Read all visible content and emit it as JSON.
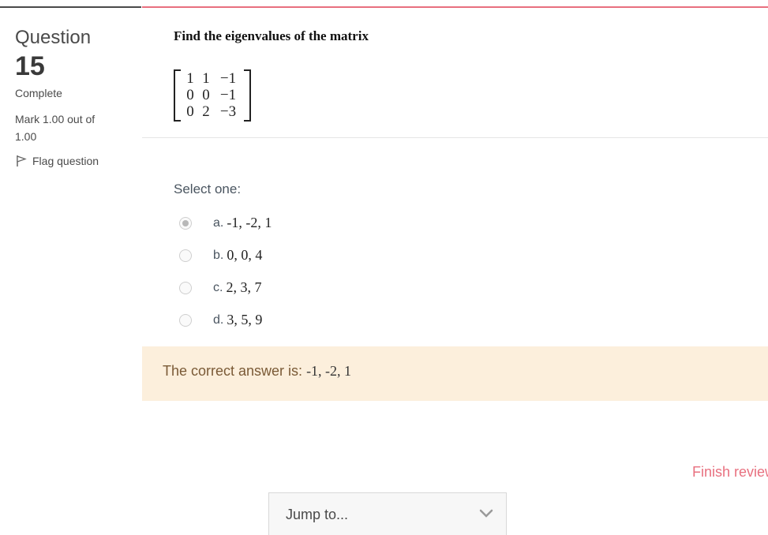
{
  "info": {
    "question_word": "Question",
    "question_number": "15",
    "state": "Complete",
    "grade": "Mark 1.00 out of 1.00",
    "flag_label": "Flag question",
    "flag_icon": "flag-icon"
  },
  "question": {
    "text": "Find the eigenvalues of the matrix",
    "matrix": [
      [
        "1",
        "1",
        "−1"
      ],
      [
        "0",
        "0",
        "−1"
      ],
      [
        "0",
        "2",
        "−3"
      ]
    ],
    "select_prompt": "Select one:",
    "options": [
      {
        "letter": "a.",
        "text": "-1, -2, 1",
        "selected": true
      },
      {
        "letter": "b.",
        "text": "0, 0, 4",
        "selected": false
      },
      {
        "letter": "c.",
        "text": "2, 3, 7",
        "selected": false
      },
      {
        "letter": "d.",
        "text": "3, 5, 9",
        "selected": false
      }
    ]
  },
  "feedback": {
    "label": "The correct answer is: ",
    "answer": "-1, -2, 1"
  },
  "nav": {
    "finish_review": "Finish review",
    "jump_to": "Jump to...",
    "jump_icon": "chevron-down-icon"
  },
  "colors": {
    "accent": "#e8707f",
    "feedback_bg": "#fcefdc"
  }
}
